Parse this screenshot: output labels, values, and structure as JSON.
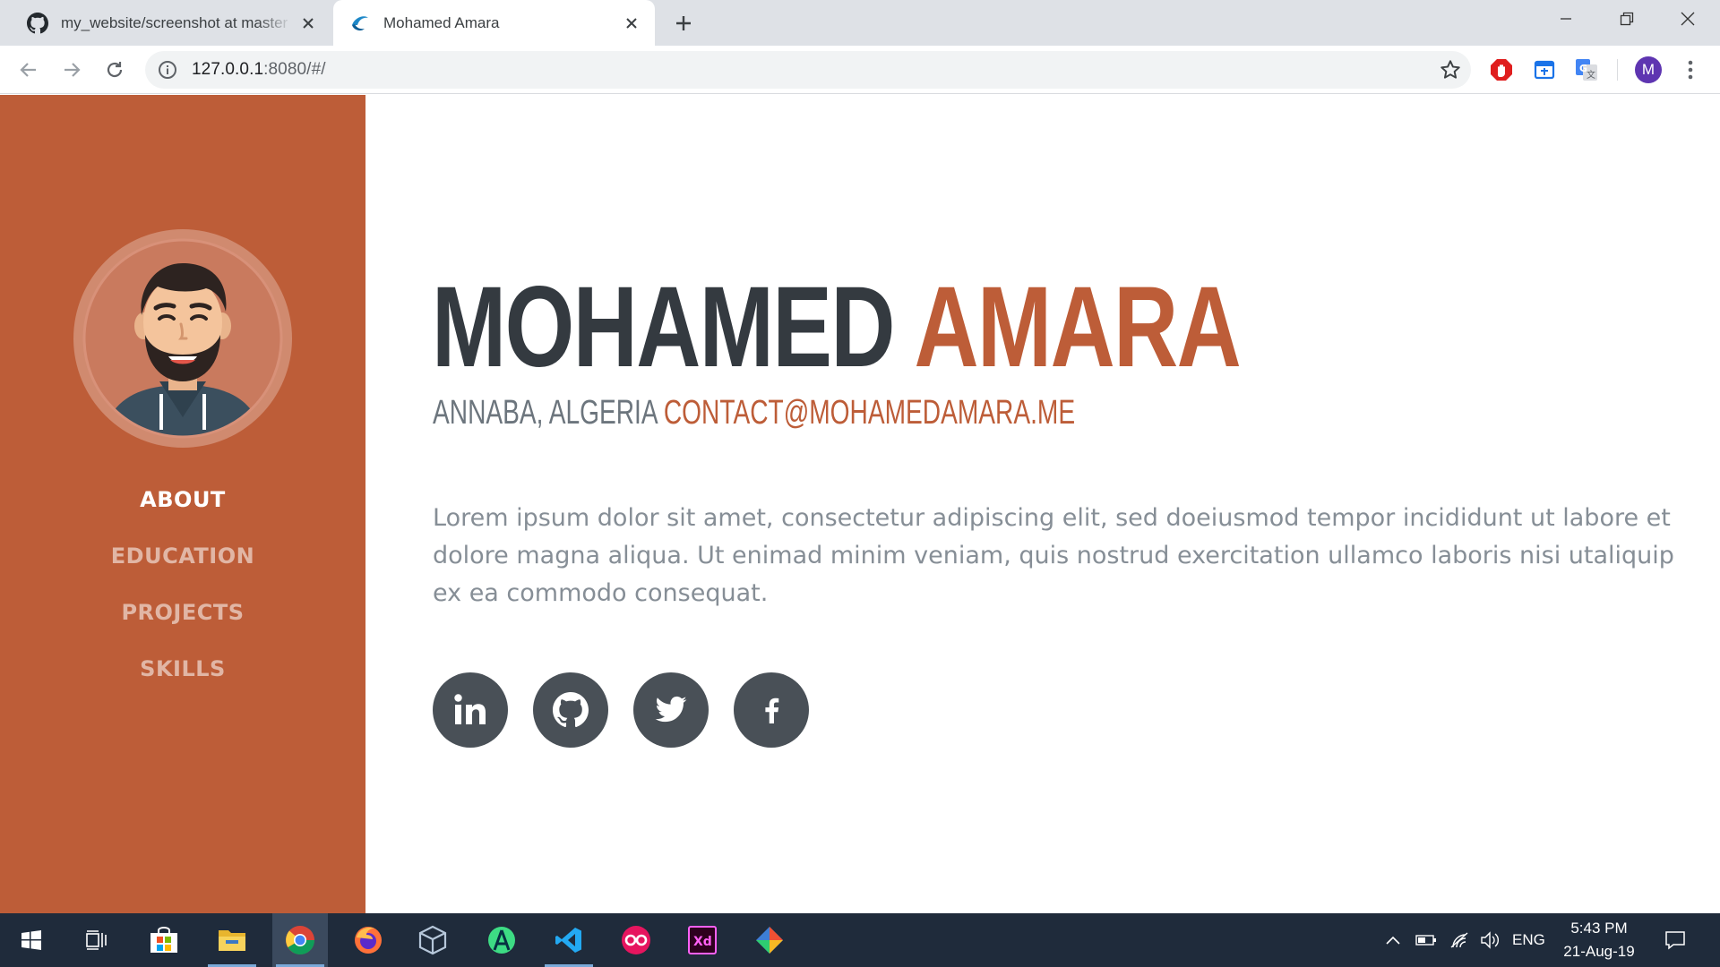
{
  "browser": {
    "tabs": [
      {
        "title": "my_website/screenshot at master",
        "icon": "github-icon",
        "active": false
      },
      {
        "title": "Mohamed Amara",
        "icon": "site-favicon",
        "active": true
      }
    ],
    "url_host": "127.0.0.1",
    "url_rest": ":8080/#/",
    "profile_initial": "M"
  },
  "profile": {
    "first_name": "MOHAMED",
    "last_name": "AMARA",
    "location": "ANNABA, ALGERIA",
    "email": "CONTACT@MOHAMEDAMARA.ME",
    "bio": "Lorem ipsum dolor sit amet, consectetur adipiscing elit, sed doeiusmod tempor incididunt ut labore et dolore magna aliqua. Ut enimad minim veniam, quis nostrud exercitation ullamco laboris nisi utaliquip ex ea commodo consequat."
  },
  "nav": {
    "items": [
      {
        "label": "ABOUT",
        "active": true
      },
      {
        "label": "EDUCATION",
        "active": false
      },
      {
        "label": "PROJECTS",
        "active": false
      },
      {
        "label": "SKILLS",
        "active": false
      }
    ]
  },
  "social": [
    {
      "name": "linkedin",
      "icon": "linkedin-icon",
      "glyph": "in"
    },
    {
      "name": "github",
      "icon": "github-icon"
    },
    {
      "name": "twitter",
      "icon": "twitter-icon"
    },
    {
      "name": "facebook",
      "icon": "facebook-icon",
      "glyph": "f"
    }
  ],
  "taskbar": {
    "time": "5:43 PM",
    "date": "21-Aug-19",
    "language": "ENG"
  },
  "colors": {
    "accent": "#bd5d38",
    "heading": "#343a40",
    "muted": "#868e96",
    "social_bg": "#495057",
    "taskbar": "#1f2b3b"
  }
}
